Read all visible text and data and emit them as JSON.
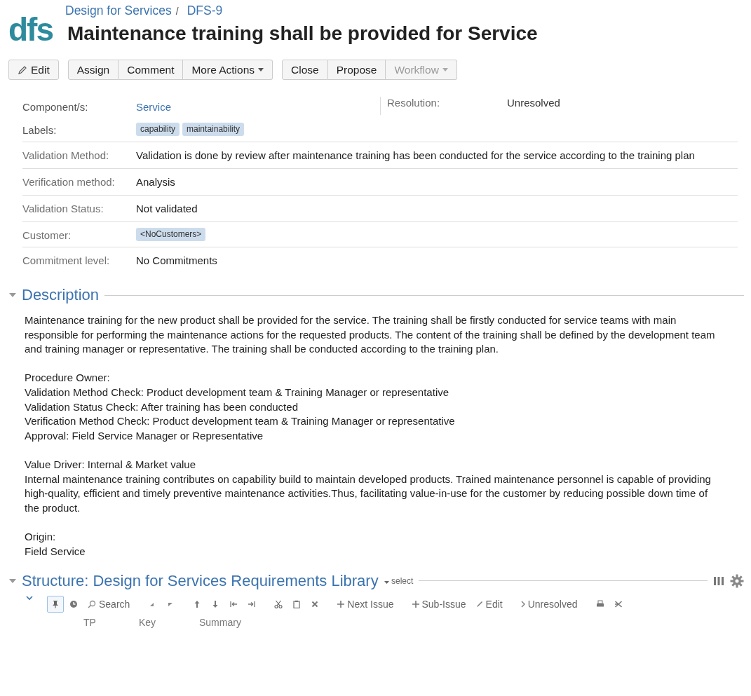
{
  "logo": "dfs",
  "breadcrumb_separator": "/",
  "breadcrumbs": [
    {
      "label": "Design for Services"
    },
    {
      "label": "DFS-9"
    }
  ],
  "title": "Maintenance training shall be provided for Service",
  "button_groups": [
    [
      {
        "label": "Edit",
        "kind": "edit",
        "disabled": false
      }
    ],
    [
      {
        "label": "Assign",
        "kind": "plain",
        "disabled": false
      },
      {
        "label": "Comment",
        "kind": "plain",
        "disabled": false
      },
      {
        "label": "More Actions",
        "kind": "menu",
        "disabled": false
      }
    ],
    [
      {
        "label": "Close",
        "kind": "plain",
        "disabled": false
      },
      {
        "label": "Propose",
        "kind": "plain",
        "disabled": false
      },
      {
        "label": "Workflow",
        "kind": "menu",
        "disabled": true
      }
    ]
  ],
  "resolution": {
    "label": "Resolution:",
    "value": "Unresolved"
  },
  "fields": [
    {
      "label": "Component/s:",
      "kind": "link",
      "value": "Service",
      "divider": false
    },
    {
      "label": "Labels:",
      "kind": "tags",
      "tags": [
        "capability",
        "maintainability"
      ],
      "divider": false
    },
    {
      "label": "Validation Method:",
      "kind": "text",
      "value": "Validation is done by review after maintenance training has been conducted for the service according to the training plan",
      "divider": true
    },
    {
      "label": "Verification method:",
      "kind": "text",
      "value": "Analysis",
      "divider": true
    },
    {
      "label": "Validation Status:",
      "kind": "text",
      "value": "Not validated",
      "divider": true
    },
    {
      "label": "Customer:",
      "kind": "tags",
      "tags": [
        "<NoCustomers>"
      ],
      "divider": true
    },
    {
      "label": "Commitment level:",
      "kind": "text",
      "value": "No Commitments",
      "divider": true
    }
  ],
  "description": {
    "heading": "Description",
    "expanded": true,
    "paragraphs": [
      [
        "Maintenance training for the new product shall be provided for the service. The training shall be firstly conducted for service teams with main responsible for performing the maintenance actions for the requested products. The content of the training shall be defined by the development team and training manager or representative. The training shall be conducted according to the training plan."
      ],
      [
        "Procedure Owner:",
        "Validation Method Check: Product development team & Training Manager or representative",
        "Validation Status Check: After training has been conducted",
        "Verification Method Check: Product development team & Training Manager or representative",
        "Approval: Field Service Manager or Representative"
      ],
      [
        "Value Driver: Internal & Market value",
        "Internal maintenance training contributes on capability build to maintain developed products. Trained maintenance personnel is capable of providing high-quality, efficient and timely preventive maintenance activities.Thus, facilitating value-in-use for the customer by reducing possible down time of the product."
      ],
      [
        "Origin:",
        "Field Service"
      ]
    ]
  },
  "structure": {
    "heading": "Structure: Design for Services Requirements Library",
    "expanded": true,
    "select": "select",
    "tools": [
      {
        "kind": "pin",
        "on": true
      },
      {
        "kind": "clock",
        "on": false
      },
      {
        "kind": "search",
        "label": "Search"
      },
      {
        "kind": "left"
      },
      {
        "kind": "right"
      },
      {
        "kind": "up"
      },
      {
        "kind": "down"
      },
      {
        "kind": "outdent"
      },
      {
        "kind": "indent"
      },
      {
        "kind": "cut"
      },
      {
        "kind": "paste"
      },
      {
        "kind": "delete"
      },
      {
        "kind": "add",
        "label": "Next Issue"
      },
      {
        "kind": "add",
        "label": "Sub-Issue"
      },
      {
        "kind": "edit",
        "label": "Edit"
      },
      {
        "kind": "filter",
        "label": "Unresolved"
      },
      {
        "kind": "print"
      },
      {
        "kind": "export"
      }
    ],
    "columns": [
      "TP",
      "Key",
      "Summary"
    ]
  }
}
